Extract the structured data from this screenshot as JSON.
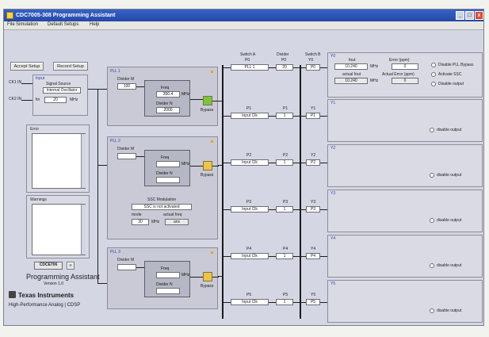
{
  "window": {
    "title": "CDC7005-308 Programming Assistant",
    "min": "_",
    "max": "□",
    "close": "x"
  },
  "menu": [
    {
      "label": "File"
    },
    {
      "label": "Simulation"
    },
    {
      "label": "Default Setups"
    },
    {
      "label": "Help"
    }
  ],
  "buttons": {
    "accept": "Accept Setup",
    "record": "Record Setup"
  },
  "inputs": {
    "ck1": "CK1 IN",
    "ck2": "CK2 IN",
    "input_label": "Input",
    "signal_source_label": "Signal Source",
    "signal_source": "Internal Oscillator",
    "fin_label": "fin",
    "fin_value": "20",
    "mhz": "MHz"
  },
  "error_label": "Error",
  "warnings_label": "Warnings",
  "pll": [
    {
      "label": "PLL 1",
      "divider_m_label": "Divider M",
      "divider_m": "100",
      "freq_label": "Freq",
      "freq": "350.4",
      "divider_n_label": "Divider N",
      "divider_n": "2000",
      "bypass": "Bypass",
      "mhz": "MHz"
    },
    {
      "label": "PLL 2",
      "divider_m_label": "Divider M",
      "divider_m": "",
      "freq_label": "Freq",
      "freq": "",
      "divider_n_label": "Divider N",
      "divider_n": "",
      "bypass": "Bypass",
      "mhz": "MHz",
      "ssc_label": "SSC Modulation",
      "ssc_status": "SSC is not activated",
      "ssc_mode": "mode",
      "ssc_actual": "actual freq",
      "ssc_mhz": "MHz",
      "ssc_mode_value": "30",
      "ssc_actual_value": "ans"
    },
    {
      "label": "PLL 3",
      "divider_m_label": "Divider M",
      "divider_m": "",
      "freq_label": "Freq",
      "freq": "",
      "divider_n_label": "Divider N",
      "divider_n": "",
      "bypass": "Bypass",
      "mhz": "MHz"
    }
  ],
  "logo": {
    "part": "CDCE706",
    "sub": "Programming Assistant",
    "version": "Version 1.0",
    "company": "Texas Instruments",
    "division": "High-Performance Analog | CDSP"
  },
  "switch_a": {
    "title": "Switch A",
    "sub": "P0",
    "value": "PLL 1"
  },
  "divider": {
    "title": "Divider",
    "sub": "P0",
    "value": "20"
  },
  "switch_b": {
    "title": "Switch B",
    "sub": "Y0",
    "value": "P0"
  },
  "rows": [
    {
      "p": "P1",
      "src": "Input Clk",
      "div": "1",
      "y": "Y1"
    },
    {
      "p": "P2",
      "src": "Input Clk",
      "div": "1",
      "y": "Y2"
    },
    {
      "p": "P3",
      "src": "Input Clk",
      "div": "1",
      "y": "Y3"
    },
    {
      "p": "P4",
      "src": "Input Clk",
      "div": "1",
      "y": "Y4"
    },
    {
      "p": "P5",
      "src": "Input Clk",
      "div": "1",
      "y": "Y5"
    }
  ],
  "outputs": {
    "y0": {
      "label": "Y0",
      "fout_label": "fout",
      "fout": "10.240",
      "mhz": "MHz",
      "actual_label": "actual fout",
      "actual": "10.240",
      "ppm_label": "PPM",
      "error_label": "Error (ppm)",
      "error": "0",
      "variance_label": "Actual Error (ppm)",
      "variance": "0"
    },
    "radio": [
      "Disable PLL Bypass",
      "Activate SSC",
      "Disable output"
    ],
    "cards": [
      {
        "label": "Y1",
        "disable": "disable output"
      },
      {
        "label": "Y2",
        "disable": "disable output"
      },
      {
        "label": "Y3",
        "disable": "disable output"
      },
      {
        "label": "Y4",
        "disable": "disable output"
      },
      {
        "label": "Y5",
        "disable": "disable output"
      }
    ]
  }
}
